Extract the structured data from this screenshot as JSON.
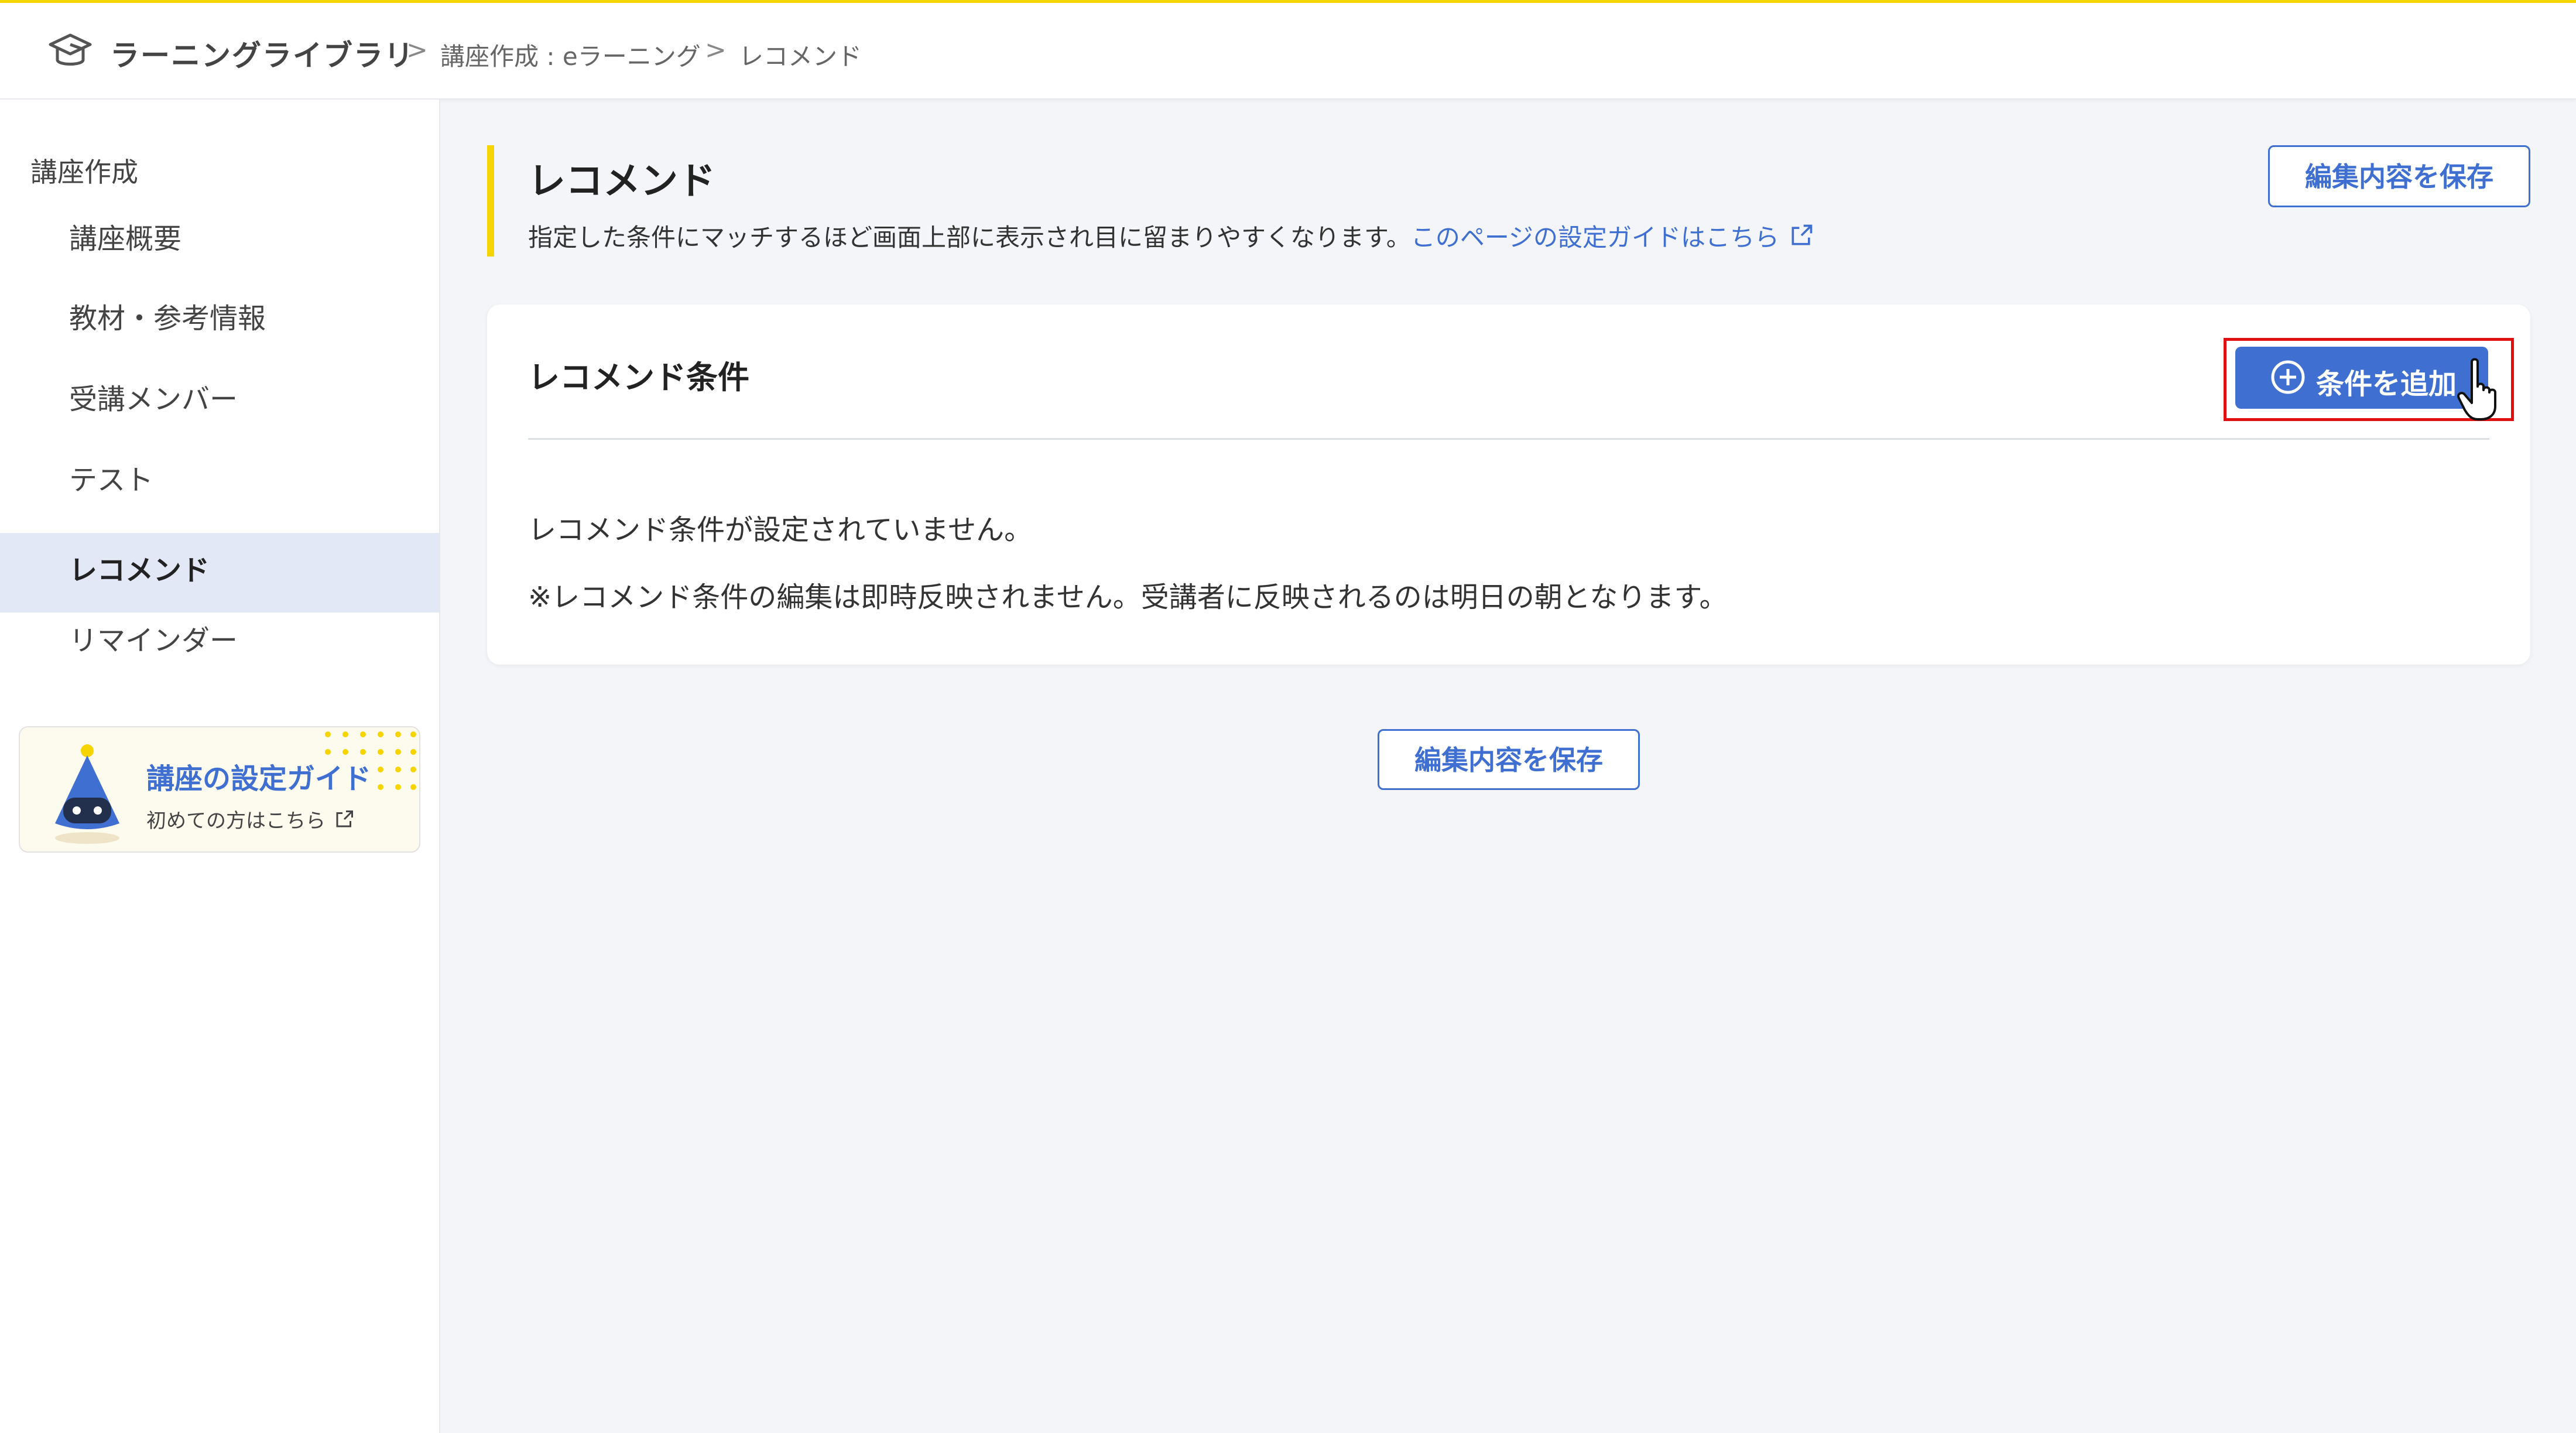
{
  "header": {
    "logo_icon": "graduation-cap-icon",
    "app_title": "ラーニングライブラリ",
    "breadcrumb": [
      "講座作成 : eラーニング",
      "レコメンド"
    ],
    "separator": ">"
  },
  "sidebar": {
    "group_label": "講座作成",
    "items": [
      {
        "label": "講座概要",
        "active": false
      },
      {
        "label": "教材・参考情報",
        "active": false
      },
      {
        "label": "受講メンバー",
        "active": false
      },
      {
        "label": "テスト",
        "active": false
      },
      {
        "label": "レコメンド",
        "active": true
      },
      {
        "label": "リマインダー",
        "active": false
      }
    ],
    "guide": {
      "title": "講座の設定ガイド",
      "subtitle": "初めての方はこちら",
      "mascot_icon": "robot-mascot-icon",
      "link_icon": "external-link-icon"
    }
  },
  "main": {
    "title": "レコメンド",
    "description": "指定した条件にマッチするほど画面上部に表示され目に留まりやすくなります。",
    "guide_link": "このページの設定ガイドはこちら",
    "save_button": "編集内容を保存",
    "card": {
      "title": "レコメンド条件",
      "add_button": "条件を追加",
      "empty_message": "レコメンド条件が設定されていません。",
      "note": "※レコメンド条件の編集は即時反映されません。受講者に反映されるのは明日の朝となります。"
    }
  },
  "colors": {
    "accent_yellow": "#f5d400",
    "primary_blue": "#3f6fd0",
    "highlight_red": "#e01010",
    "active_bg": "#e2e8f6"
  }
}
